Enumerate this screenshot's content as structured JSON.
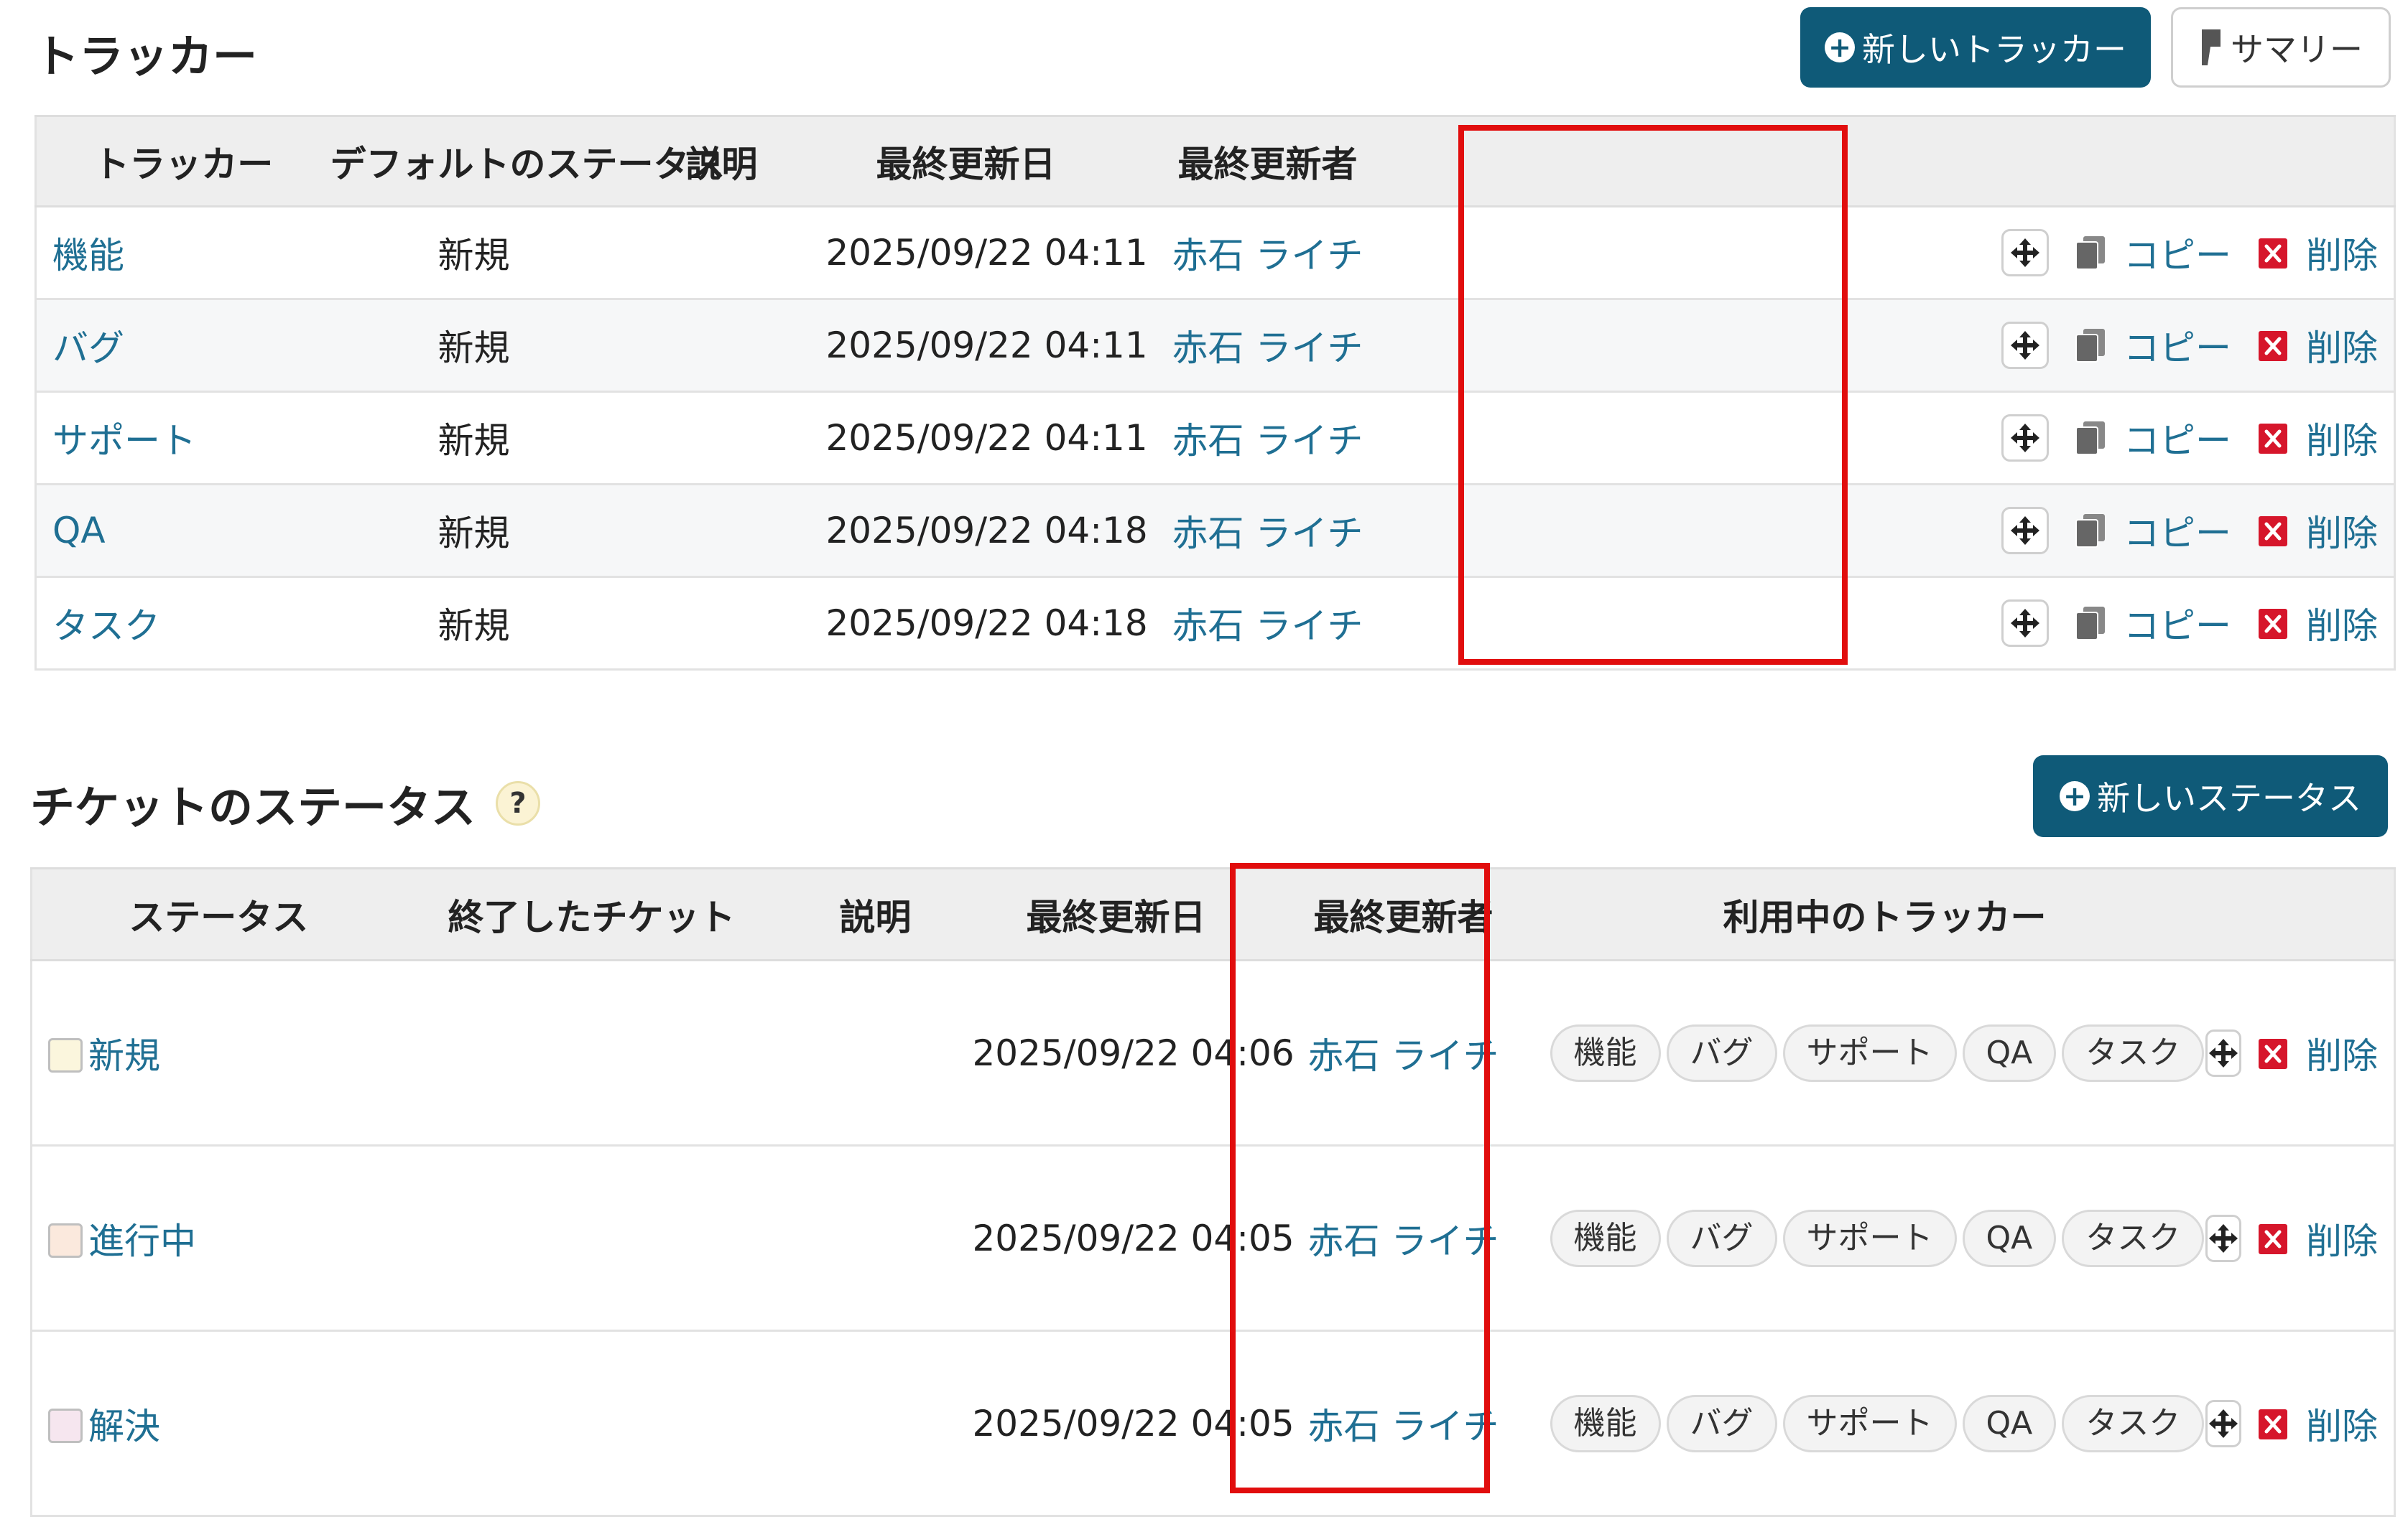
{
  "trackers": {
    "title": "トラッカー",
    "new_button": "新しいトラッカー",
    "summary_button": "サマリー",
    "columns": [
      "トラッカー",
      "デフォルトのステータス",
      "説明",
      "最終更新日",
      "最終更新者"
    ],
    "rows": [
      {
        "name": "機能",
        "status": "新規",
        "description": "",
        "updated_on": "2025/09/22 04:11",
        "updated_by": "赤石 ライチ"
      },
      {
        "name": "バグ",
        "status": "新規",
        "description": "",
        "updated_on": "2025/09/22 04:11",
        "updated_by": "赤石 ライチ"
      },
      {
        "name": "サポート",
        "status": "新規",
        "description": "",
        "updated_on": "2025/09/22 04:11",
        "updated_by": "赤石 ライチ"
      },
      {
        "name": "QA",
        "status": "新規",
        "description": "",
        "updated_on": "2025/09/22 04:18",
        "updated_by": "赤石 ライチ"
      },
      {
        "name": "タスク",
        "status": "新規",
        "description": "",
        "updated_on": "2025/09/22 04:18",
        "updated_by": "赤石 ライチ"
      }
    ],
    "copy_label": "コピー",
    "delete_label": "削除"
  },
  "statuses": {
    "title": "チケットのステータス",
    "help_label": "?",
    "new_button": "新しいステータス",
    "columns": [
      "ステータス",
      "終了したチケット",
      "説明",
      "最終更新日",
      "最終更新者",
      "利用中のトラッカー"
    ],
    "rows": [
      {
        "name": "新規",
        "updated_on": "2025/09/22 04:06",
        "updated_by": "赤石 ライチ",
        "trackers": [
          "機能",
          "バグ",
          "サポート",
          "QA",
          "タスク"
        ],
        "box_color": "#fbf6dd"
      },
      {
        "name": "進行中",
        "updated_on": "2025/09/22 04:05",
        "updated_by": "赤石 ライチ",
        "trackers": [
          "機能",
          "バグ",
          "サポート",
          "QA",
          "タスク"
        ],
        "box_color": "#fbe9dd"
      },
      {
        "name": "解決",
        "updated_on": "2025/09/22 04:05",
        "updated_by": "赤石 ライチ",
        "trackers": [
          "機能",
          "バグ",
          "サポート",
          "QA",
          "タスク"
        ],
        "box_color": "#f6e6ef"
      }
    ],
    "delete_label": "削除"
  },
  "colors": {
    "primary_button": "#0f5a78",
    "link": "#1f6f93",
    "highlight": "#e10d0d",
    "delete_icon": "#d6162b"
  }
}
